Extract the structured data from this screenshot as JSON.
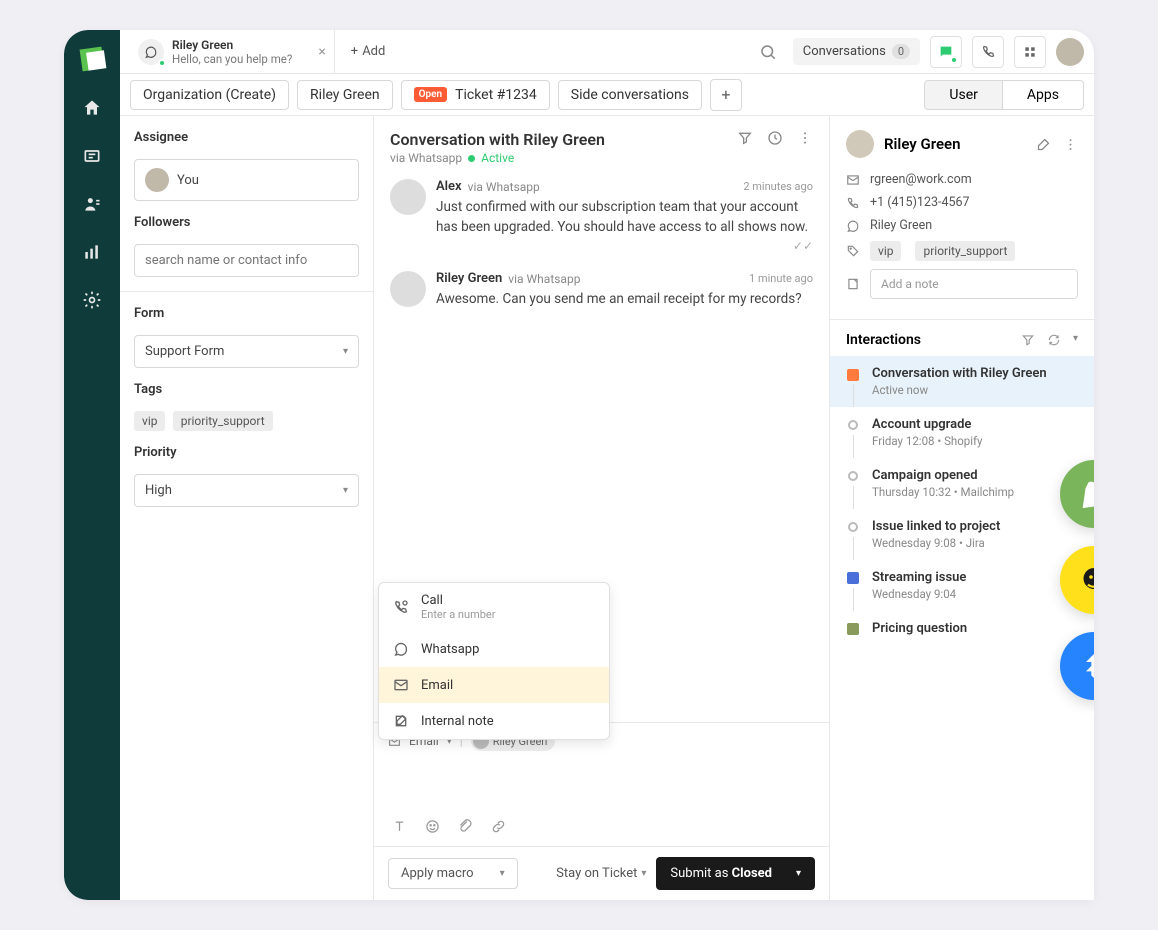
{
  "top_tab": {
    "name": "Riley Green",
    "subtitle": "Hello, can you help me?"
  },
  "add_label": "Add",
  "conversations_btn": {
    "label": "Conversations",
    "count": "0"
  },
  "subtabs": {
    "org": "Organization (Create)",
    "person": "Riley Green",
    "ticket_badge": "Open",
    "ticket": "Ticket #1234",
    "side": "Side conversations",
    "user_tab": "User",
    "apps_tab": "Apps"
  },
  "left": {
    "assignee_label": "Assignee",
    "assignee_value": "You",
    "followers_label": "Followers",
    "followers_placeholder": "search name or contact info",
    "form_label": "Form",
    "form_value": "Support Form",
    "tags_label": "Tags",
    "tag1": "vip",
    "tag2": "priority_support",
    "priority_label": "Priority",
    "priority_value": "High"
  },
  "conv": {
    "title": "Conversation with Riley Green",
    "via": "via Whatsapp",
    "status": "Active"
  },
  "messages": [
    {
      "name": "Alex",
      "via": "via Whatsapp",
      "time": "2 minutes ago",
      "text": "Just confirmed with our subscription team that your account has been upgraded. You should have access to all shows now."
    },
    {
      "name": "Riley Green",
      "via": "via Whatsapp",
      "time": "1 minute ago",
      "text": "Awesome. Can you send me an email receipt for my records?"
    }
  ],
  "channel_menu": {
    "call": "Call",
    "call_sub": "Enter a number",
    "whatsapp": "Whatsapp",
    "email": "Email",
    "note": "Internal note"
  },
  "compose": {
    "channel": "Email",
    "recipient": "Riley Green"
  },
  "footer": {
    "macro": "Apply macro",
    "stay": "Stay on Ticket",
    "submit_pre": "Submit as ",
    "submit_status": "Closed"
  },
  "profile": {
    "name": "Riley Green",
    "email": "rgreen@work.com",
    "phone": "+1 (415)123-4567",
    "wa": "Riley Green",
    "tag1": "vip",
    "tag2": "priority_support",
    "note_placeholder": "Add a note"
  },
  "interactions": {
    "title": "Interactions",
    "items": [
      {
        "title": "Conversation with Riley Green",
        "sub": "Active now",
        "active": true
      },
      {
        "title": "Account upgrade",
        "sub": "Friday 12:08 • Shopify"
      },
      {
        "title": "Campaign opened",
        "sub": "Thursday 10:32 • Mailchimp"
      },
      {
        "title": "Issue linked to project",
        "sub": "Wednesday 9:08 • Jira"
      },
      {
        "title": "Streaming issue",
        "sub": "Wednesday 9:04",
        "badge": "p"
      },
      {
        "title": "Pricing question",
        "sub": "",
        "badge": "s"
      }
    ]
  }
}
